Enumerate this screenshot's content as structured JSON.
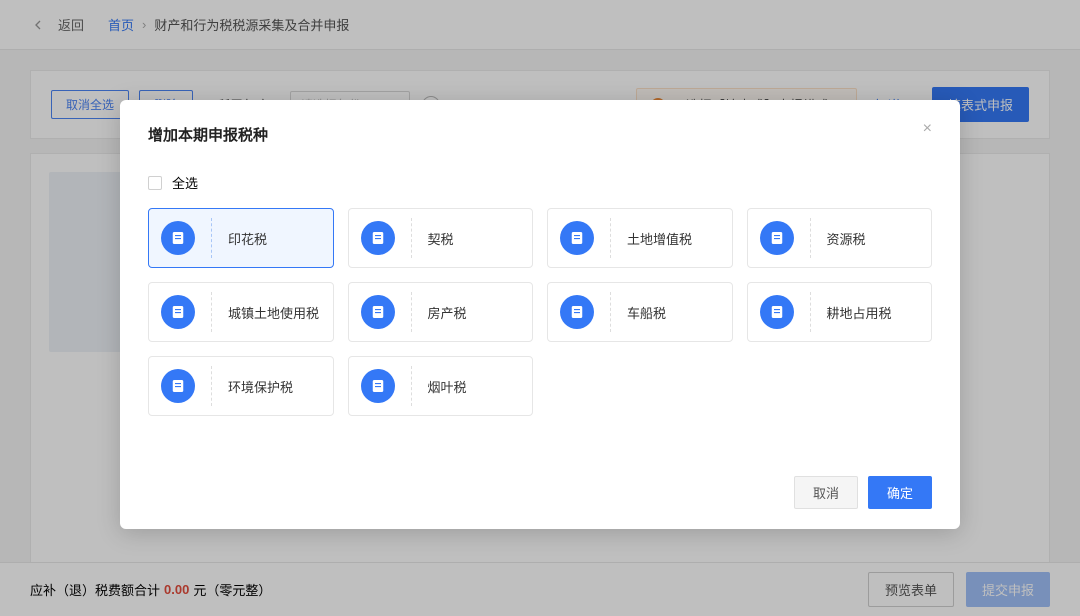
{
  "header": {
    "back_label": "返回",
    "breadcrumb_home": "首页",
    "breadcrumb_current": "财产和行为税税源采集及合并申报"
  },
  "toolbar": {
    "deselect_all": "取消全选",
    "delete": "删除",
    "year_label": "所属年度：",
    "year_placeholder": "请选择年份",
    "alert_text": "可选择【填表式】申报模式！",
    "know_link": "知道了",
    "form_declare_btn": "填表式申报"
  },
  "modal": {
    "title": "增加本期申报税种",
    "select_all": "全选",
    "tax_types": [
      {
        "label": "印花税",
        "icon": "stamp-icon",
        "selected": true
      },
      {
        "label": "契税",
        "icon": "contract-icon",
        "selected": false
      },
      {
        "label": "土地增值税",
        "icon": "landval-icon",
        "selected": false
      },
      {
        "label": "资源税",
        "icon": "resource-icon",
        "selected": false
      },
      {
        "label": "城镇土地使用税",
        "icon": "urban-land-icon",
        "selected": false
      },
      {
        "label": "房产税",
        "icon": "property-icon",
        "selected": false
      },
      {
        "label": "车船税",
        "icon": "vehicle-icon",
        "selected": false
      },
      {
        "label": "耕地占用税",
        "icon": "farmland-icon",
        "selected": false
      },
      {
        "label": "环境保护税",
        "icon": "environment-icon",
        "selected": false
      },
      {
        "label": "烟叶税",
        "icon": "tobacco-icon",
        "selected": false
      }
    ],
    "cancel": "取消",
    "confirm": "确定"
  },
  "footer": {
    "label_prefix": "应补（退）税费额合计",
    "amount": "0.00",
    "unit": "元",
    "amount_words": "（零元整）",
    "preview_btn": "预览表单",
    "submit_btn": "提交申报"
  }
}
